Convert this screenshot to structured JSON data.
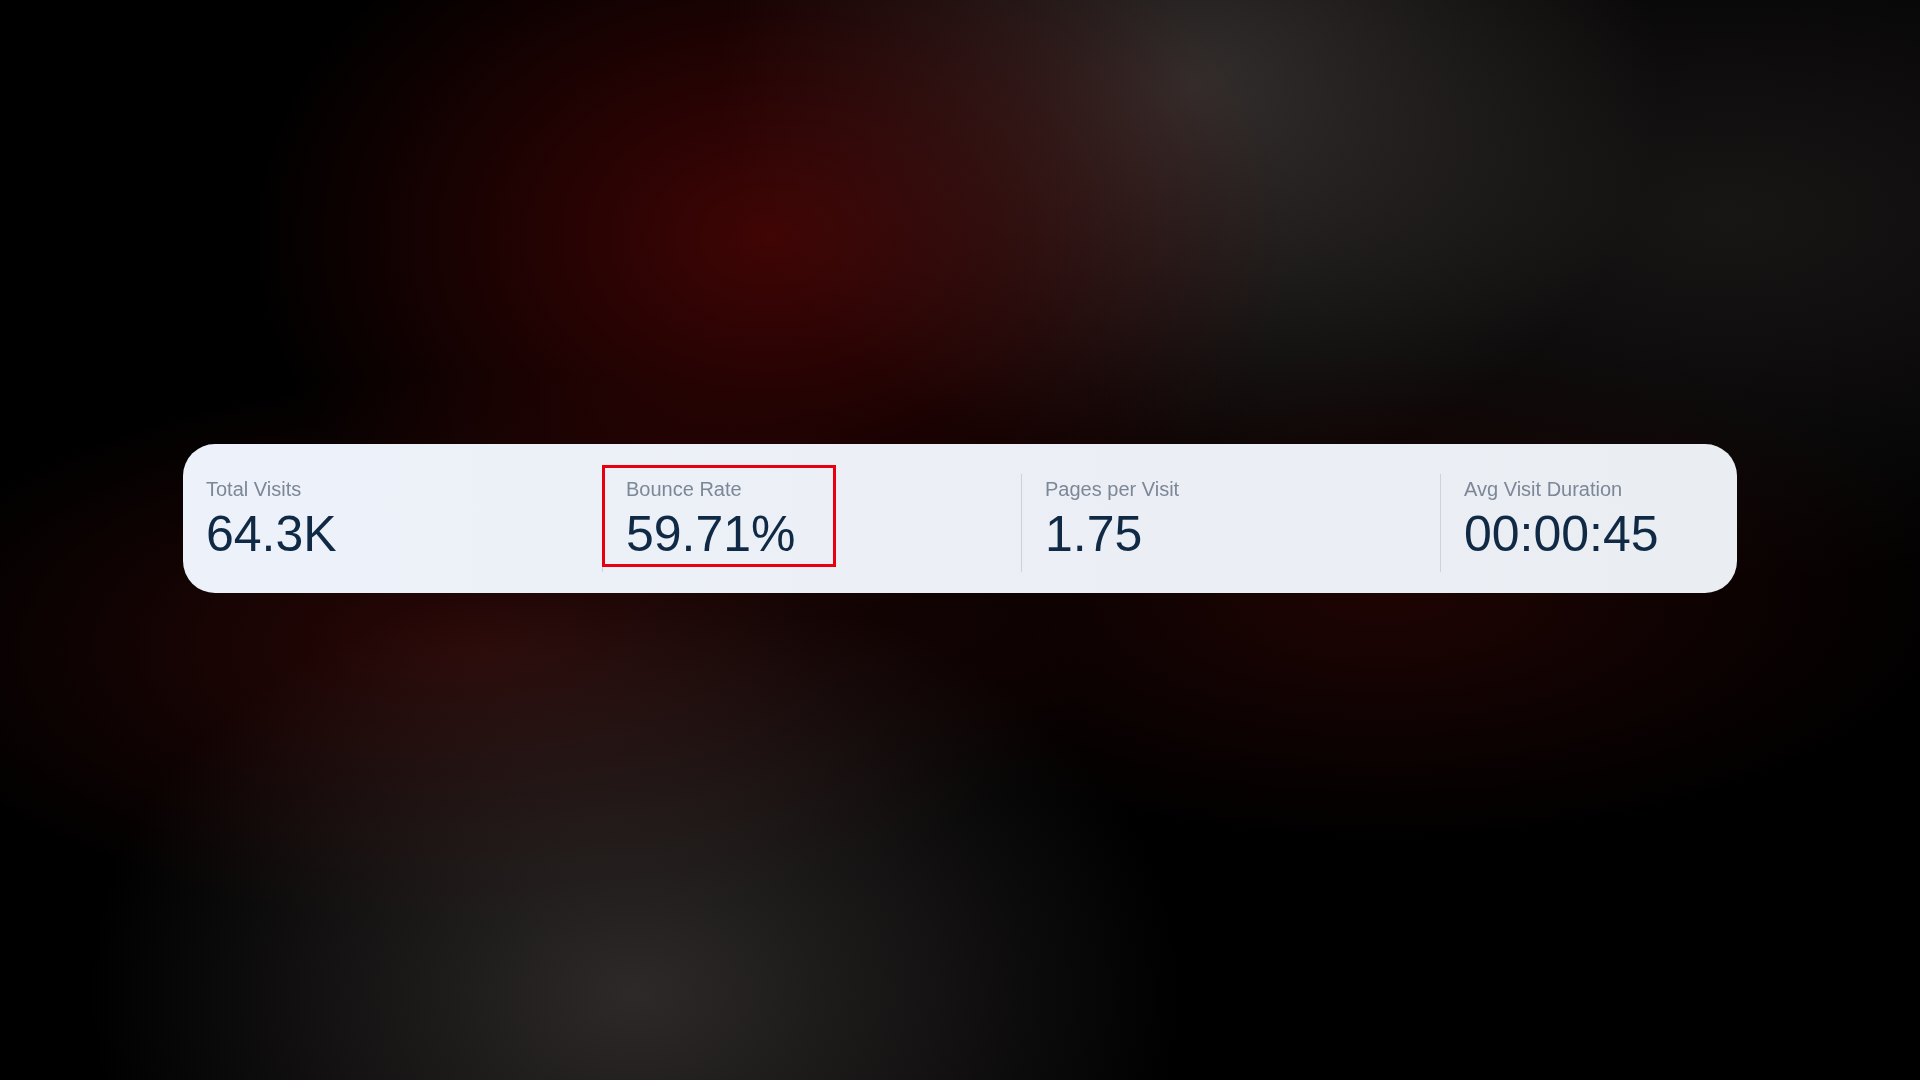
{
  "metrics": [
    {
      "label": "Total Visits",
      "value": "64.3K",
      "highlighted": false
    },
    {
      "label": "Bounce Rate",
      "value": "59.71%",
      "highlighted": true
    },
    {
      "label": "Pages per Visit",
      "value": "1.75",
      "highlighted": false
    },
    {
      "label": "Avg Visit Duration",
      "value": "00:00:45",
      "highlighted": false
    }
  ]
}
